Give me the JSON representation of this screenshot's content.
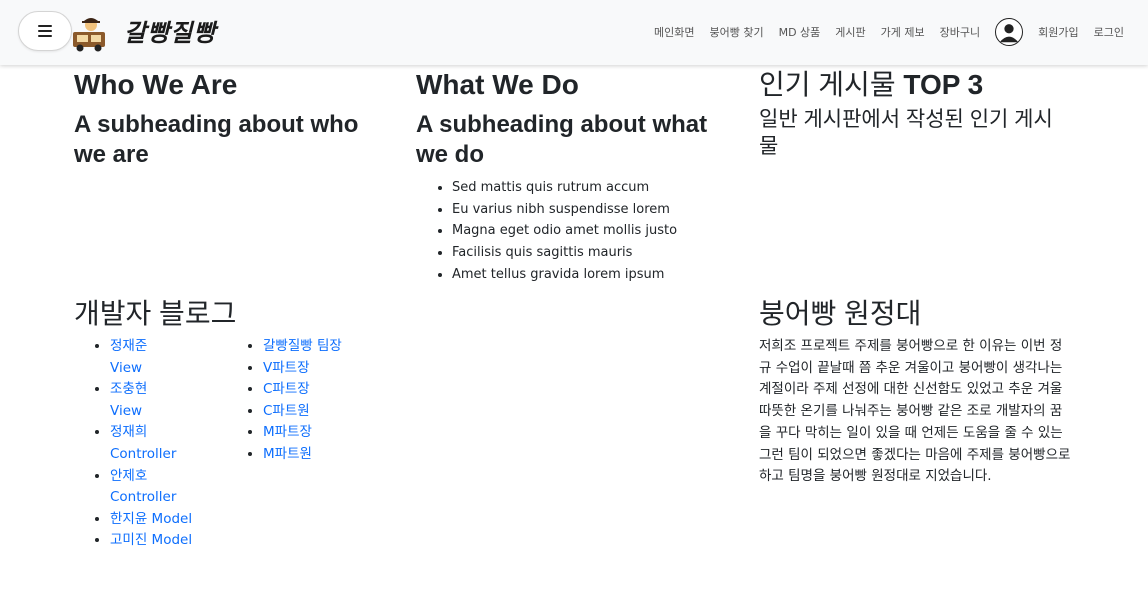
{
  "header": {
    "brand": "갈빵질빵",
    "nav": [
      "메인화면",
      "붕어빵 찾기",
      "MD 상품",
      "게시판",
      "가게 제보",
      "장바구니"
    ],
    "signup": "회원가입",
    "login": "로그인"
  },
  "who": {
    "title": "Who We Are",
    "subtitle": "A subheading about who we are"
  },
  "what": {
    "title": "What We Do",
    "subtitle": "A subheading about what we do",
    "items": [
      "Sed mattis quis rutrum accum",
      "Eu varius nibh suspendisse lorem",
      "Magna eget odio amet mollis justo",
      "Facilisis quis sagittis mauris",
      "Amet tellus gravida lorem ipsum"
    ]
  },
  "popular": {
    "title_prefix": "인기 게시물 ",
    "title_strong": "TOP 3",
    "subtitle": "일반 게시판에서 작성된 인기 게시물"
  },
  "blog": {
    "title": "개발자 블로그",
    "left": [
      "정재준 View",
      "조충현 View",
      "정재희 Controller",
      "안제호 Controller",
      "한지윤 Model",
      "고미진 Model"
    ],
    "right": [
      "갈빵질빵 팀장",
      "V파트장",
      "C파트장",
      "C파트원",
      "M파트장",
      "M파트원"
    ]
  },
  "expedition": {
    "title": "붕어빵 원정대",
    "body": "저희조 프로젝트 주제를 붕어빵으로 한 이유는 이번 정규 수업이 끝날때 쯤 추운 겨울이고 붕어빵이 생각나는 계절이라 주제 선정에 대한 신선함도 있었고 추운 겨울 따뜻한 온기를 나눠주는 붕어빵 같은 조로 개발자의 꿈을 꾸다 막히는 일이 있을 때 언제든 도움을 줄 수 있는 그런 팀이 되었으면 좋겠다는 마음에 주제를 붕어빵으로 하고 팀명을 붕어빵 원정대로 지었습니다."
  }
}
